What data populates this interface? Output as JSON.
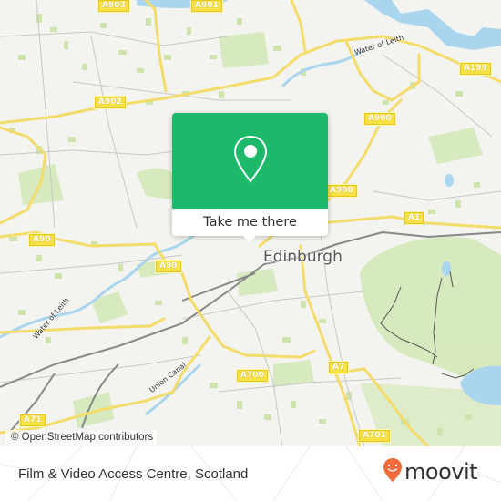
{
  "map": {
    "city_label": "Edinburgh",
    "road_labels": {
      "a903": "A903",
      "a901": "A901",
      "a902": "A902",
      "a199": "A199",
      "a900_top": "A900",
      "a900_mid": "A900",
      "a1": "A1",
      "a90_left": "A90",
      "a90_mid": "A90",
      "a700": "A700",
      "a7": "A7",
      "a701": "A701",
      "a71": "A71"
    },
    "water_labels": {
      "water_of_leith_top": "Water of Leith",
      "water_of_leith_left": "Water of Leith",
      "union_canal": "Union Canal"
    },
    "attribution": "© OpenStreetMap contributors"
  },
  "popup": {
    "icon": "map-pin-icon",
    "button_label": "Take me there",
    "accent_color": "#1db96a"
  },
  "footer": {
    "place_title": "Film & Video Access Centre, Scotland",
    "brand_name": "moovit",
    "brand_color": "#f26b3a"
  }
}
